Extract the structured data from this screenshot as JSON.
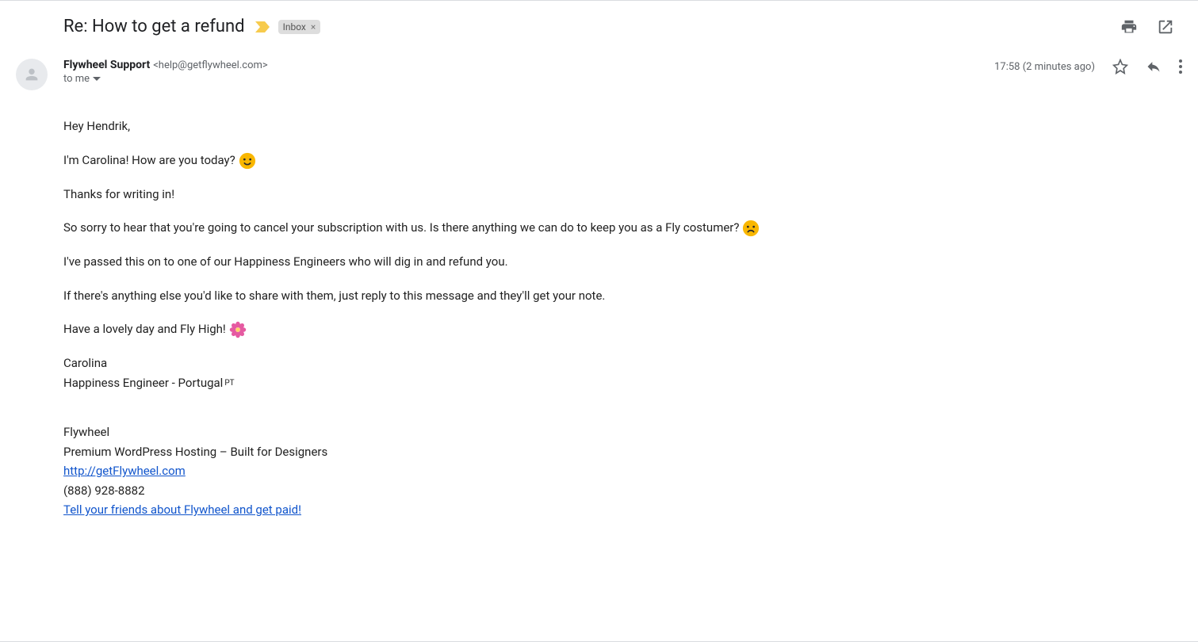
{
  "subject": "Re: How to get a refund",
  "label": "Inbox",
  "sender": {
    "name": "Flywheel Support",
    "email": "<help@getflywheel.com>"
  },
  "to_line": "to me",
  "timestamp": "17:58 (2 minutes ago)",
  "body": {
    "p1": "Hey Hendrik,",
    "p2": "I'm Carolina! How are you today?",
    "p3": "Thanks for writing in!",
    "p4": "So sorry to hear that you're going to cancel your subscription with us. Is there anything we can do to keep you as a Fly costumer?",
    "p5": "I've passed this on to one of our Happiness Engineers who will dig in and refund you.",
    "p6": "If there's anything else you'd like to share with them, just reply to this message and they'll get your note.",
    "p7": "Have a lovely day and Fly High!"
  },
  "signature": {
    "name": "Carolina",
    "title": "Happiness Engineer - Portugal",
    "flag": "PT",
    "company": "Flywheel",
    "tagline": "Premium WordPress Hosting – Built for Designers",
    "url": "http://getFlywheel.com",
    "phone": "(888) 928-8882",
    "referral": "Tell your friends about Flywheel and get paid!"
  }
}
